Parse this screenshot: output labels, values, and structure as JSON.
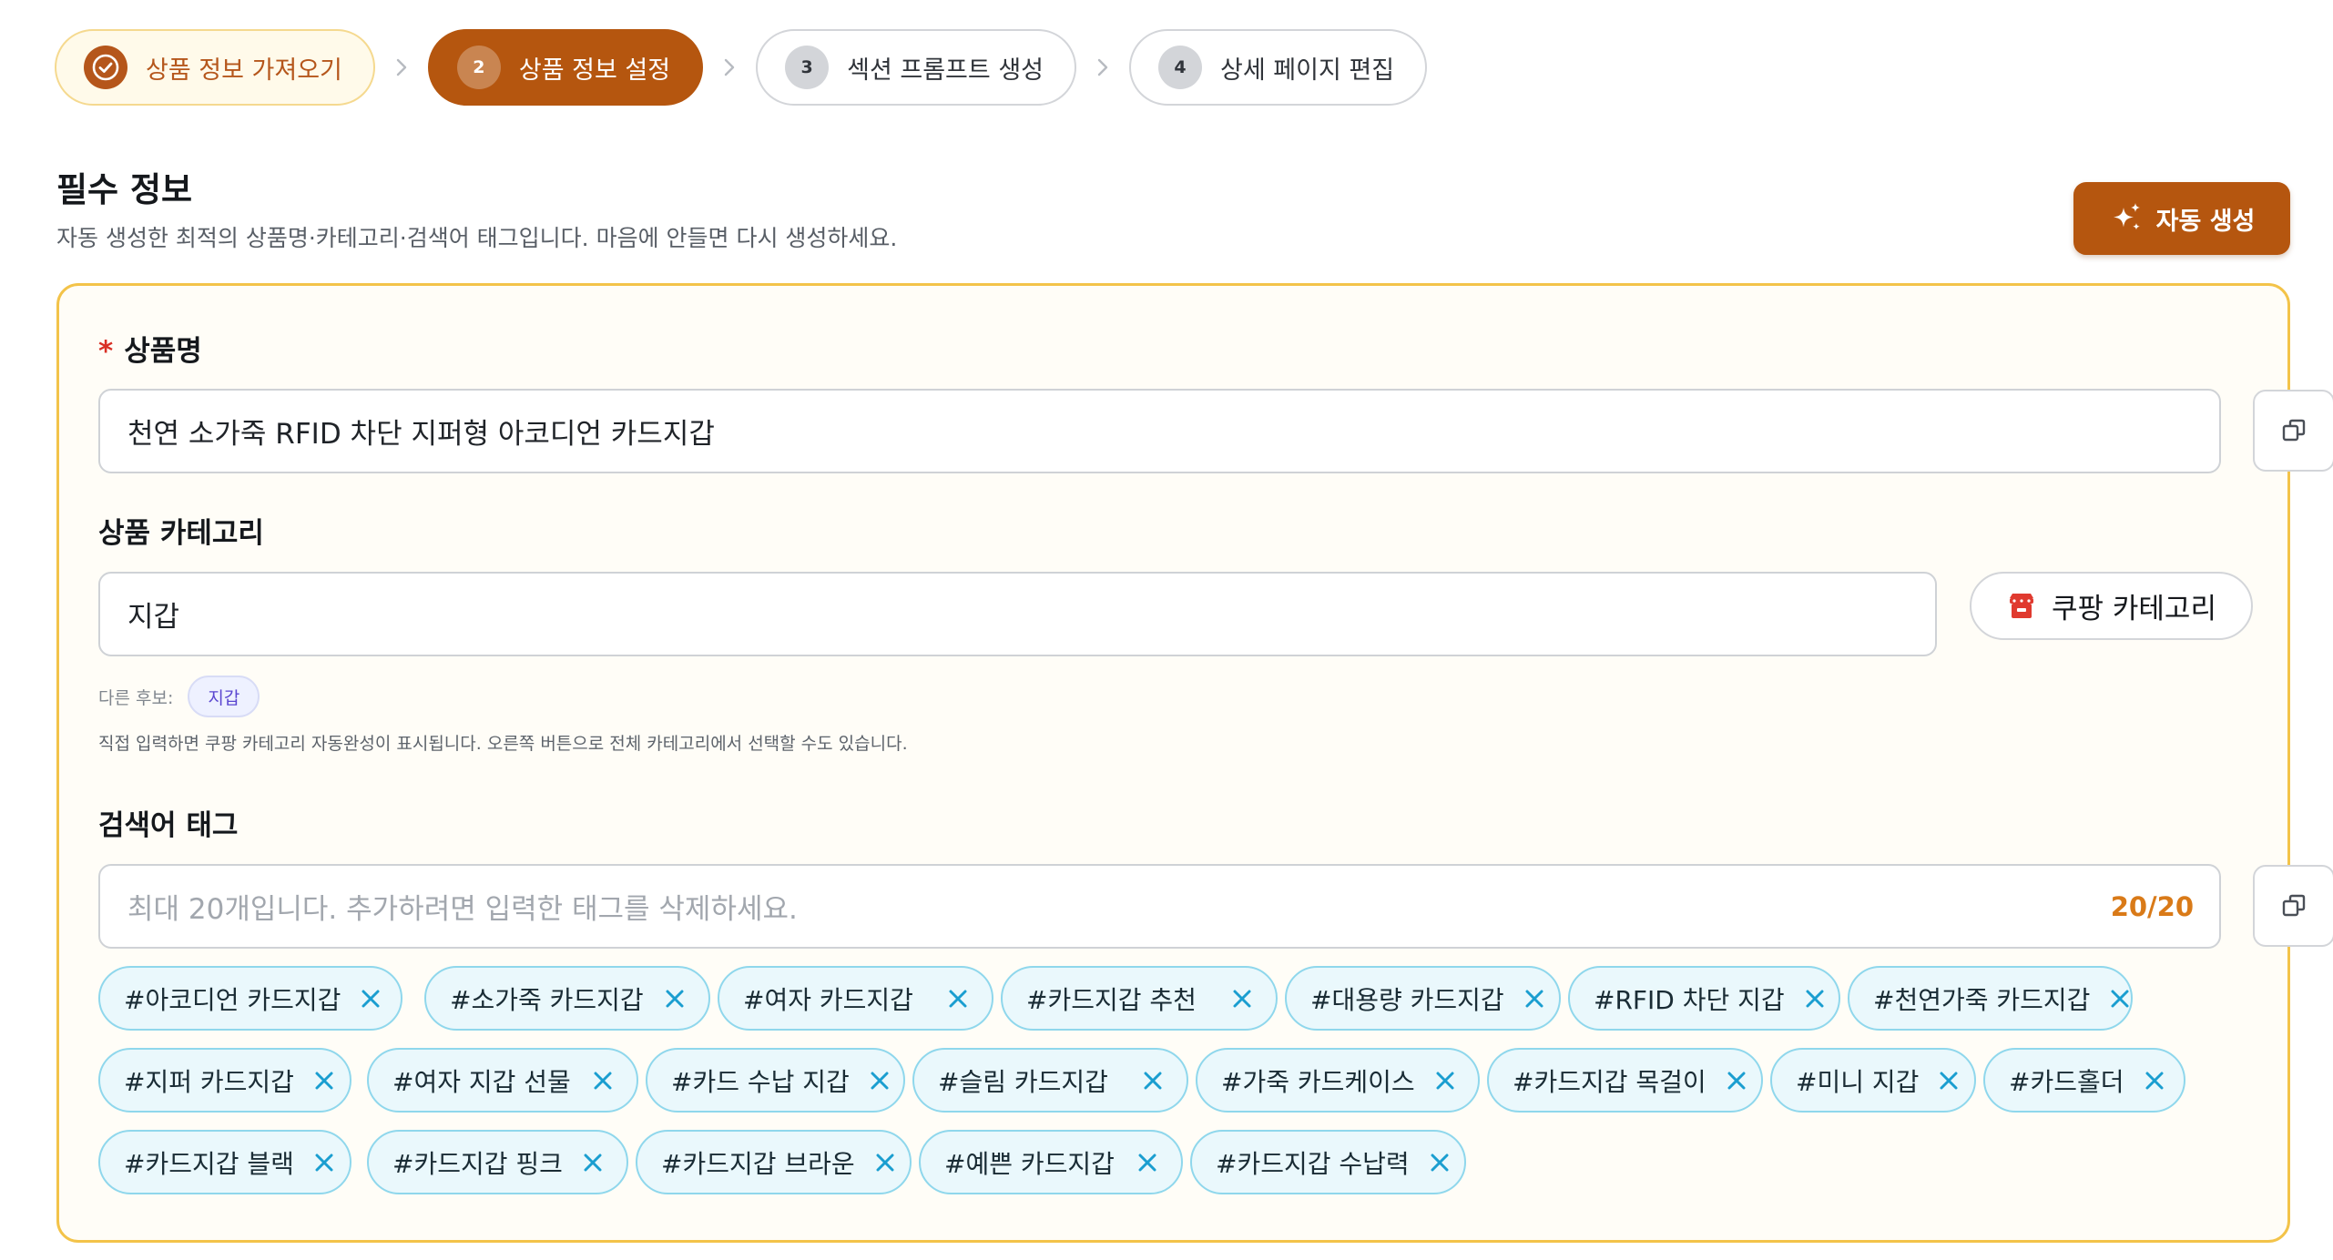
{
  "stepper": {
    "steps": [
      {
        "num": "",
        "label": "상품 정보 가져오기",
        "state": "done"
      },
      {
        "num": "2",
        "label": "상품 정보 설정",
        "state": "active"
      },
      {
        "num": "3",
        "label": "섹션 프롬프트 생성",
        "state": "idle"
      },
      {
        "num": "4",
        "label": "상세 페이지 편집",
        "state": "idle"
      }
    ]
  },
  "section": {
    "title": "필수 정보",
    "subtitle": "자동 생성한 최적의 상품명·카테고리·검색어 태그입니다. 마음에 안들면 다시 생성하세요.",
    "auto_button_label": "자동 생성"
  },
  "product_name": {
    "required_mark": "*",
    "label": "상품명",
    "value": "천연 소가죽 RFID 차단 지퍼형 아코디언 카드지갑"
  },
  "category": {
    "label": "상품 카테고리",
    "value": "지갑",
    "coupang_button_label": "쿠팡 카테고리",
    "candidates_label": "다른 후보:",
    "candidates": [
      "지갑"
    ],
    "hint": "직접 입력하면 쿠팡 카테고리 자동완성이 표시됩니다. 오른쪽 버튼으로 전체 카테고리에서 선택할 수도 있습니다."
  },
  "search_tags": {
    "label": "검색어 태그",
    "placeholder": "최대 20개입니다. 추가하려면 입력한 태그를 삭제하세요.",
    "counter": "20/20",
    "tags": [
      "#아코디언 카드지갑",
      "#소가죽 카드지갑",
      "#여자 카드지갑",
      "#카드지갑 추천",
      "#대용량 카드지갑",
      "#RFID 차단 지갑",
      "#천연가죽 카드지갑",
      "#지퍼 카드지갑",
      "#여자 지갑 선물",
      "#카드 수납 지갑",
      "#슬림 카드지갑",
      "#가죽 카드케이스",
      "#카드지갑 목걸이",
      "#미니 지갑",
      "#카드홀더",
      "#카드지갑 블랙",
      "#카드지갑 핑크",
      "#카드지갑 브라운",
      "#예쁜 카드지갑",
      "#카드지갑 수납력"
    ]
  },
  "colors": {
    "accent": "#b5560f",
    "card_border": "#f3c349",
    "tag_border": "#8fd7ec",
    "tag_bg": "#eaf8fc",
    "tag_x": "#1a9ed0",
    "counter": "#d97a18"
  },
  "icons": {
    "step_done": "check-circle-icon",
    "step_separator": "chevron-right-icon",
    "auto_generate": "sparkles-icon",
    "copy": "copy-icon",
    "coupang": "store-icon",
    "tag_remove": "close-icon"
  }
}
